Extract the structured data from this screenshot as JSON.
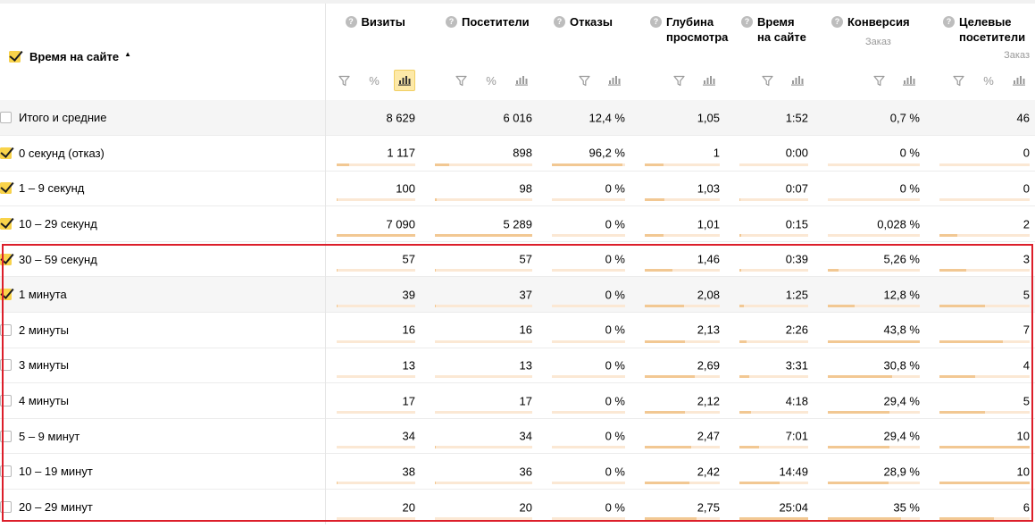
{
  "dimension": {
    "title": "Время на сайте",
    "sort_icon": "sort-asc-icon"
  },
  "columns": [
    {
      "key": "visits",
      "name": "Визиты",
      "goal": "",
      "tools": [
        "filter",
        "percent",
        "bars-active"
      ]
    },
    {
      "key": "visitors",
      "name": "Посетители",
      "goal": "",
      "tools": [
        "filter",
        "percent",
        "bars"
      ]
    },
    {
      "key": "bounces",
      "name": "Отказы",
      "goal": "",
      "tools": [
        "filter",
        "bars"
      ]
    },
    {
      "key": "depth",
      "name": "Глубина\nпросмотра",
      "goal": "",
      "tools": [
        "filter",
        "bars"
      ]
    },
    {
      "key": "time",
      "name": "Время\nна сайте",
      "goal": "",
      "tools": [
        "filter",
        "bars"
      ]
    },
    {
      "key": "conv",
      "name": "Конверсия",
      "goal": "Заказ",
      "tools": [
        "filter",
        "bars"
      ]
    },
    {
      "key": "target",
      "name": "Целевые\nпосетители",
      "goal": "Заказ",
      "tools": [
        "filter",
        "percent",
        "bars"
      ]
    }
  ],
  "total": {
    "label": "Итого и средние",
    "values": [
      "8 629",
      "6 016",
      "12,4 %",
      "1,05",
      "1:52",
      "0,7 %",
      "46"
    ]
  },
  "rows": [
    {
      "label": "0 секунд (отказ)",
      "checked": true,
      "values": [
        "1 117",
        "898",
        "96,2 %",
        "1",
        "0:00",
        "0 %",
        "0"
      ],
      "bars": [
        0.16,
        0.15,
        0.96,
        0.25,
        0.0,
        0.0,
        0.0
      ]
    },
    {
      "label": "1 – 9 секунд",
      "checked": true,
      "values": [
        "100",
        "98",
        "0 %",
        "1,03",
        "0:07",
        "0 %",
        "0"
      ],
      "bars": [
        0.02,
        0.02,
        0.0,
        0.26,
        0.01,
        0.0,
        0.0
      ]
    },
    {
      "label": "10 – 29 секунд",
      "checked": true,
      "values": [
        "7 090",
        "5 289",
        "0 %",
        "1,01",
        "0:15",
        "0,028 %",
        "2"
      ],
      "bars": [
        1.0,
        1.0,
        0.0,
        0.25,
        0.02,
        0.0,
        0.2
      ]
    },
    {
      "label": "30 – 59 секунд",
      "checked": true,
      "values": [
        "57",
        "57",
        "0 %",
        "1,46",
        "0:39",
        "5,26 %",
        "3"
      ],
      "bars": [
        0.01,
        0.01,
        0.0,
        0.37,
        0.03,
        0.12,
        0.3
      ]
    },
    {
      "label": "1 минута",
      "checked": true,
      "highlight": true,
      "values": [
        "39",
        "37",
        "0 %",
        "2,08",
        "1:25",
        "12,8 %",
        "5"
      ],
      "bars": [
        0.01,
        0.01,
        0.0,
        0.52,
        0.06,
        0.29,
        0.5
      ]
    },
    {
      "label": "2 минуты",
      "checked": false,
      "values": [
        "16",
        "16",
        "0 %",
        "2,13",
        "2:26",
        "43,8 %",
        "7"
      ],
      "bars": [
        0.0,
        0.0,
        0.0,
        0.53,
        0.1,
        1.0,
        0.7
      ]
    },
    {
      "label": "3 минуты",
      "checked": false,
      "values": [
        "13",
        "13",
        "0 %",
        "2,69",
        "3:31",
        "30,8 %",
        "4"
      ],
      "bars": [
        0.0,
        0.0,
        0.0,
        0.67,
        0.14,
        0.7,
        0.4
      ]
    },
    {
      "label": "4 минуты",
      "checked": false,
      "values": [
        "17",
        "17",
        "0 %",
        "2,12",
        "4:18",
        "29,4 %",
        "5"
      ],
      "bars": [
        0.0,
        0.0,
        0.0,
        0.53,
        0.17,
        0.67,
        0.5
      ]
    },
    {
      "label": "5 – 9 минут",
      "checked": false,
      "values": [
        "34",
        "34",
        "0 %",
        "2,47",
        "7:01",
        "29,4 %",
        "10"
      ],
      "bars": [
        0.0,
        0.01,
        0.0,
        0.62,
        0.28,
        0.67,
        1.0
      ]
    },
    {
      "label": "10 – 19 минут",
      "checked": false,
      "values": [
        "38",
        "36",
        "0 %",
        "2,42",
        "14:49",
        "28,9 %",
        "10"
      ],
      "bars": [
        0.01,
        0.01,
        0.0,
        0.6,
        0.59,
        0.66,
        1.0
      ]
    },
    {
      "label": "20 – 29 минут",
      "checked": false,
      "values": [
        "20",
        "20",
        "0 %",
        "2,75",
        "25:04",
        "35 %",
        "6"
      ],
      "bars": [
        0.0,
        0.0,
        0.0,
        0.69,
        1.0,
        0.8,
        0.6
      ]
    }
  ],
  "colors": {
    "bar_fill": "#f2c893",
    "bar_track": "#fbe8d4",
    "checkbox_on": "#f9d34a",
    "highlight_border": "#dc1e2a",
    "active_tool": "#fde9a8"
  }
}
